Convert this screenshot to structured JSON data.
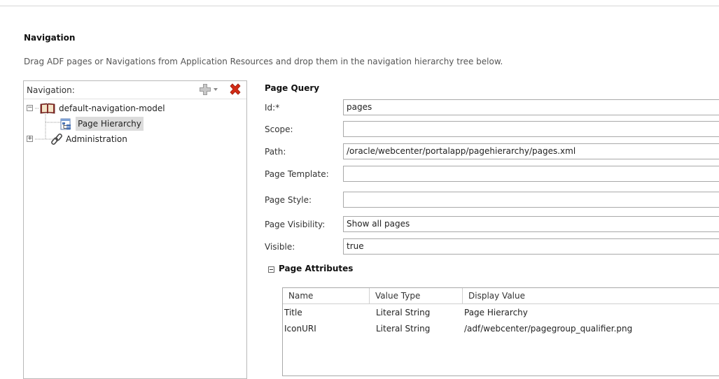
{
  "header": {
    "title": "Navigation",
    "subtitle": "Drag ADF pages or Navigations from Application Resources and drop them in the navigation hierarchy tree below."
  },
  "navigation_panel": {
    "label": "Navigation:",
    "add_icon": "add-icon",
    "delete_icon": "delete-icon",
    "tree": [
      {
        "label": "default-navigation-model",
        "expanded": true,
        "icon": "book-icon"
      },
      {
        "label": "Page Hierarchy",
        "selected": true,
        "icon": "page-hierarchy-icon"
      },
      {
        "label": "Administration",
        "expanded": false,
        "icon": "link-icon"
      }
    ]
  },
  "page_query": {
    "section_title": "Page Query",
    "fields": {
      "id": {
        "label": "Id:*",
        "value": "pages"
      },
      "scope": {
        "label": "Scope:",
        "value": ""
      },
      "path": {
        "label": "Path:",
        "value": "/oracle/webcenter/portalapp/pagehierarchy/pages.xml"
      },
      "page_template": {
        "label": "Page Template:",
        "value": ""
      },
      "page_style": {
        "label": "Page Style:",
        "value": ""
      },
      "page_visibility": {
        "label": "Page Visibility:",
        "value": "Show all pages"
      },
      "visible": {
        "label": "Visible:",
        "value": "true"
      }
    }
  },
  "page_attributes": {
    "section_title": "Page Attributes",
    "columns": [
      "Name",
      "Value Type",
      "Display Value"
    ],
    "rows": [
      [
        "Title",
        "Literal String",
        "Page Hierarchy"
      ],
      [
        "IconURI",
        "Literal String",
        "/adf/webcenter/pagegroup_qualifier.png"
      ]
    ]
  },
  "colors": {
    "delete": "#d22b16",
    "add": "#8a8a8a",
    "selection": "#dcdcdc"
  }
}
